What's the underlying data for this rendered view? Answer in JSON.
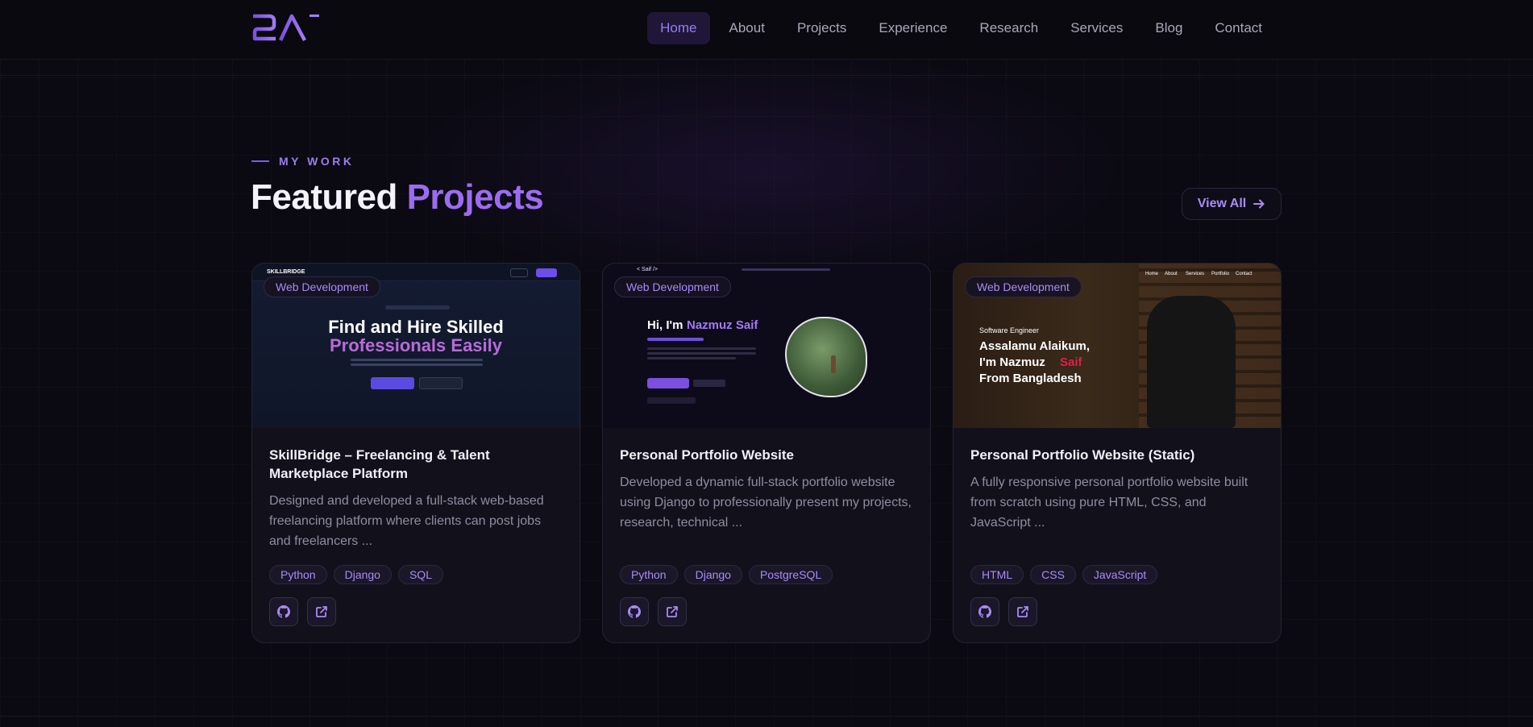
{
  "nav": {
    "logo_text": "2A",
    "links": [
      "Home",
      "About",
      "Projects",
      "Experience",
      "Research",
      "Services",
      "Blog",
      "Contact"
    ],
    "active": "Home"
  },
  "section": {
    "eyebrow": "MY WORK",
    "title_part1": "Featured",
    "title_part2": "Projects",
    "view_all": "View All"
  },
  "projects": [
    {
      "category": "Web Development",
      "title": "SkillBridge – Freelancing & Talent Marketplace Platform",
      "description": "Designed and developed a full-stack web-based freelancing platform where clients can post jobs and freelancers ...",
      "tags": [
        "Python",
        "Django",
        "SQL"
      ],
      "preview": {
        "brand": "SKILLBRIDGE",
        "heading_line1": "Find and Hire Skilled",
        "heading_line2": "Professionals Easily"
      }
    },
    {
      "category": "Web Development",
      "title": "Personal Portfolio Website",
      "description": "Developed a dynamic full-stack portfolio website using Django to professionally present my projects, research, technical ...",
      "tags": [
        "Python",
        "Django",
        "PostgreSQL"
      ],
      "preview": {
        "brand": "< Saif />",
        "greeting": "Hi, I'm",
        "name": "Nazmuz Saif"
      }
    },
    {
      "category": "Web Development",
      "title": "Personal Portfolio Website (Static)",
      "description": "A fully responsive personal portfolio website built from scratch using pure HTML, CSS, and JavaScript ...",
      "tags": [
        "HTML",
        "CSS",
        "JavaScript"
      ],
      "preview": {
        "role": "Software Engineer",
        "line1": "Assalamu Alaikum,",
        "line2a": "I'm Nazmuz",
        "line2b": "Saif",
        "line3": "From Bangladesh",
        "nav": [
          "Home",
          "About",
          "Services",
          "Portfolio",
          "Contact"
        ]
      }
    }
  ],
  "colors": {
    "background": "#0b0a12",
    "accent": "#9c6cf0",
    "card": "#12111b",
    "highlight_red": "#e11d48"
  },
  "icons": {
    "github": "github-icon",
    "external": "external-link-icon",
    "arrow": "arrow-right-icon"
  }
}
